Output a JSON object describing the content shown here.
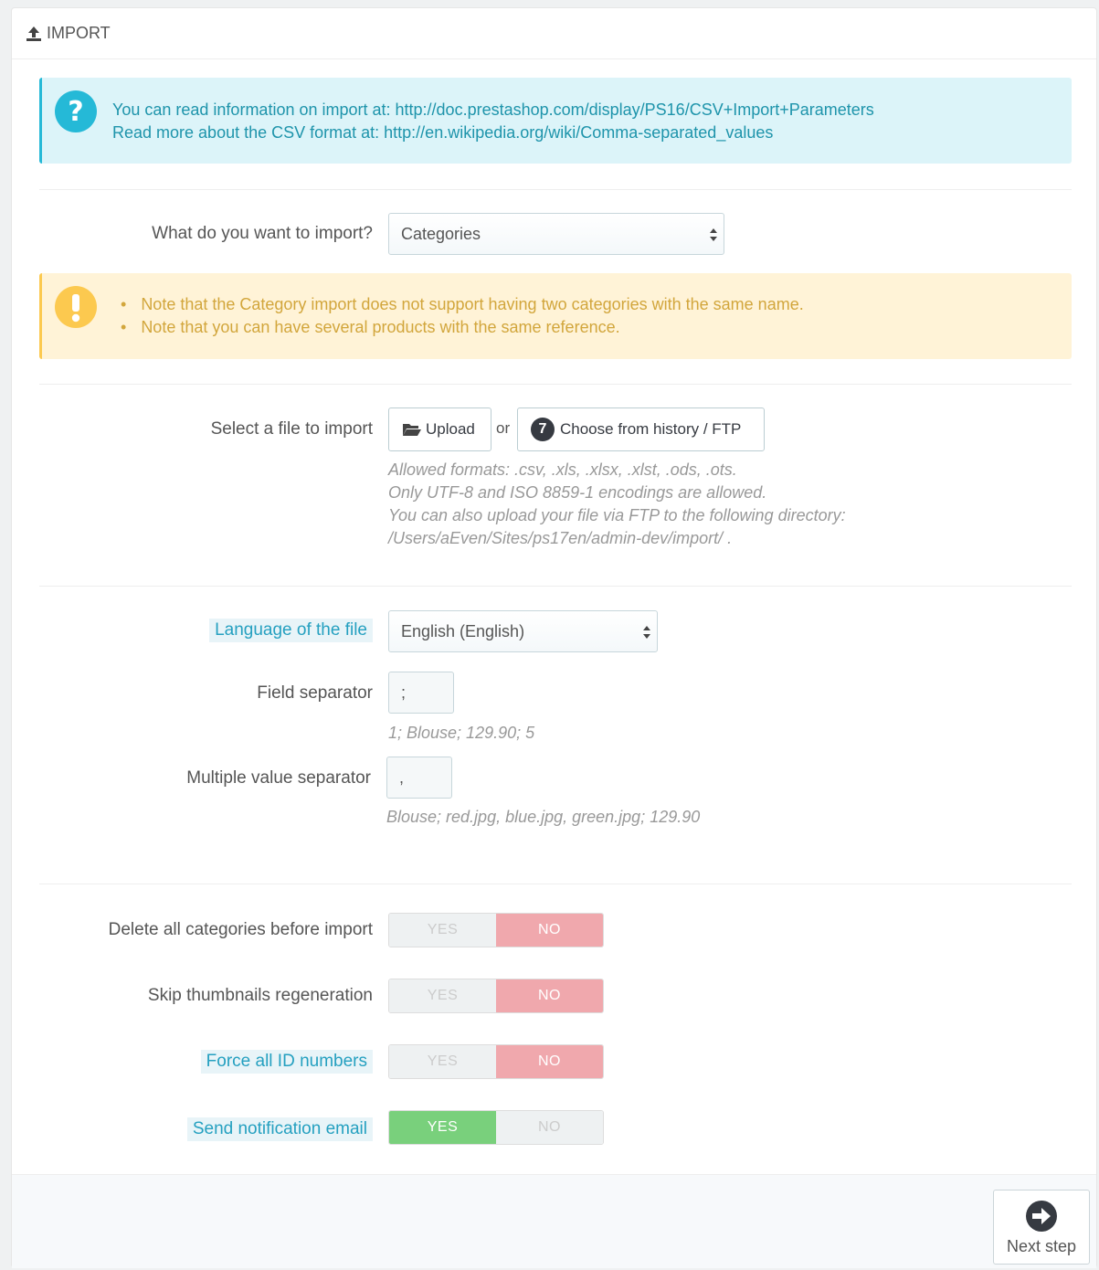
{
  "panel": {
    "title": "IMPORT"
  },
  "info": {
    "line1_text": "You can read information on import at: ",
    "line1_link": "http://doc.prestashop.com/display/PS16/CSV+Import+Parameters",
    "line2_text": "Read more about the CSV format at: ",
    "line2_link": "http://en.wikipedia.org/wiki/Comma-separated_values"
  },
  "entity": {
    "label": "What do you want to import?",
    "value": "Categories"
  },
  "warnings": [
    "Note that the Category import does not support having two categories with the same name.",
    "Note that you can have several products with the same reference."
  ],
  "file": {
    "label": "Select a file to import",
    "upload": "Upload",
    "or": "or",
    "history_badge": "7",
    "history": "Choose from history / FTP",
    "help": [
      "Allowed formats: .csv, .xls, .xlsx, .xlst, .ods, .ots.",
      "Only UTF-8 and ISO 8859-1 encodings are allowed.",
      "You can also upload your file via FTP to the following directory:",
      "/Users/aEven/Sites/ps17en/admin-dev/import/ ."
    ]
  },
  "language": {
    "label": "Language of the file",
    "value": "English (English)"
  },
  "field_separator": {
    "label": "Field separator",
    "value": ";",
    "help": "1; Blouse; 129.90; 5"
  },
  "multi_separator": {
    "label": "Multiple value separator",
    "value": ",",
    "help": "Blouse; red.jpg, blue.jpg, green.jpg; 129.90"
  },
  "switches": [
    {
      "label": "Delete all categories before import",
      "yes": "YES",
      "no": "NO",
      "value": "NO"
    },
    {
      "label": "Skip thumbnails regeneration",
      "yes": "YES",
      "no": "NO",
      "value": "NO"
    },
    {
      "label": "Force all ID numbers",
      "yes": "YES",
      "no": "NO",
      "value": "NO"
    },
    {
      "label": "Send notification email",
      "yes": "YES",
      "no": "NO",
      "value": "YES"
    }
  ],
  "footer": {
    "next": "Next step"
  },
  "colors": {
    "info": "#25b9d7",
    "warning": "#fcc94f",
    "switch_no": "#f0a8ad",
    "switch_yes": "#79d07c"
  }
}
